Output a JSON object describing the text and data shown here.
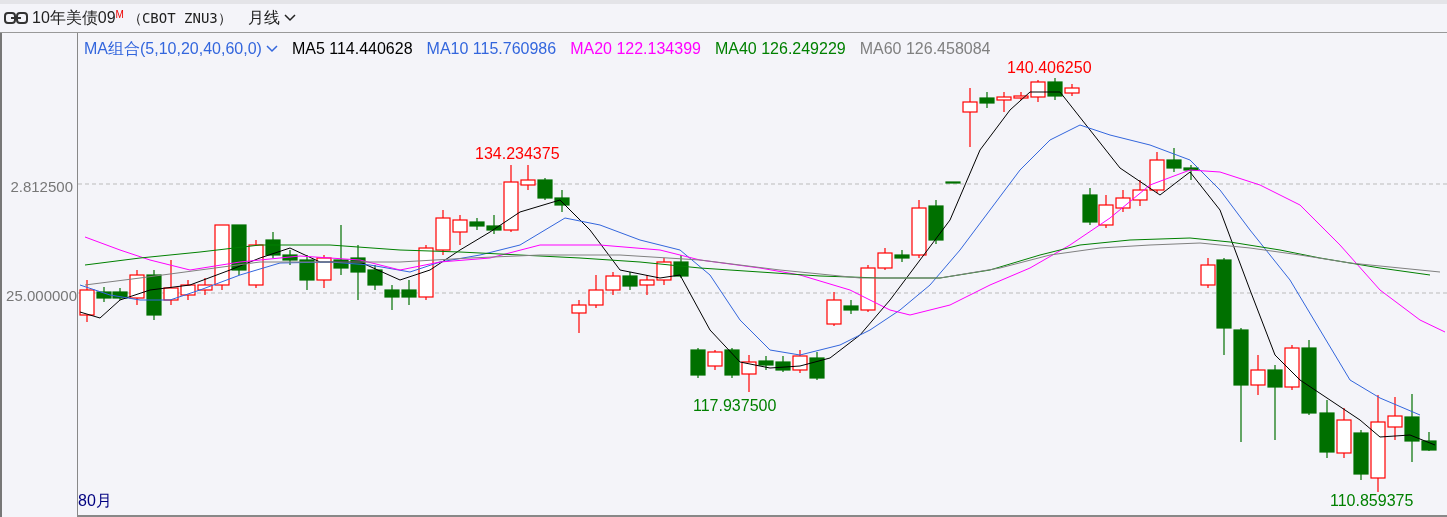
{
  "header": {
    "title": "10年美债09$^{M}$",
    "code": "（CBOT ZNU3）",
    "period": "月线"
  },
  "legend": {
    "indicator": "MA组合(5,10,20,40,60,0)",
    "items": [
      {
        "label": "MA5",
        "value": "114.440628",
        "color": "#000000"
      },
      {
        "label": "MA10",
        "value": "115.760986",
        "color": "#3366dd"
      },
      {
        "label": "MA20",
        "value": "122.134399",
        "color": "#ff00ff"
      },
      {
        "label": "MA40",
        "value": "126.249229",
        "color": "#008000"
      },
      {
        "label": "MA60",
        "value": "126.458084",
        "color": "#808080"
      }
    ]
  },
  "y_axis": {
    "labels": [
      "2.812500",
      "25.000000"
    ]
  },
  "price_marks": [
    {
      "text": "134.234375",
      "color": "#ff0000"
    },
    {
      "text": "117.937500",
      "color": "#008000"
    },
    {
      "text": "140.406250",
      "color": "#ff0000"
    },
    {
      "text": "110.859375",
      "color": "#008000"
    }
  ],
  "x_axis": {
    "label": "80月"
  }
}
